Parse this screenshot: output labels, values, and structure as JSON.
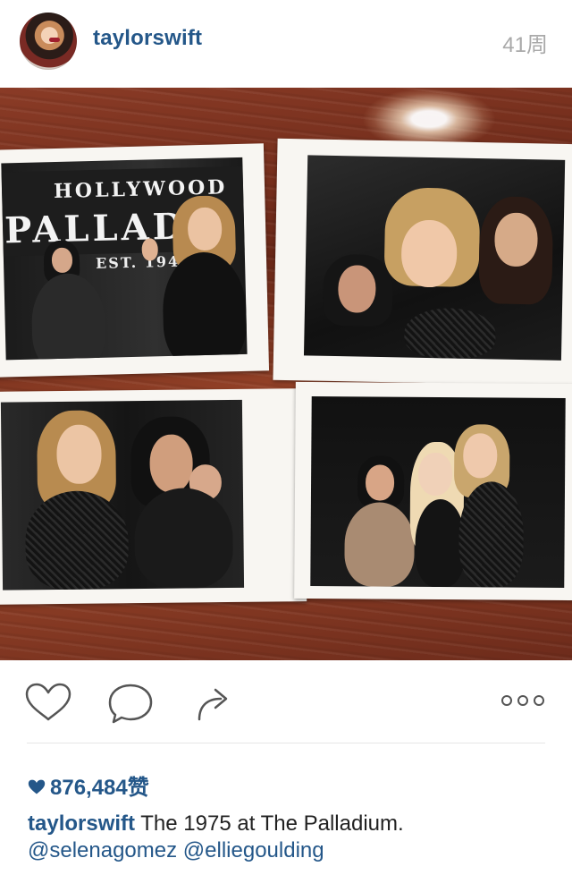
{
  "header": {
    "username": "taylorswift",
    "time_ago": "41周",
    "avatar_icon": "user-avatar"
  },
  "post": {
    "description": "",
    "photos": [
      {
        "sign_line1": "HOLLYWOOD",
        "sign_line2": "PALLAD",
        "sign_line3": "EST. 194"
      },
      {},
      {},
      {}
    ]
  },
  "actions": {
    "like_icon": "heart-outline-icon",
    "comment_icon": "comment-bubble-icon",
    "share_icon": "share-arrow-icon",
    "more_icon": "more-horizontal-icon"
  },
  "likes": {
    "icon": "heart-filled-icon",
    "count": "876,484",
    "suffix": "赞"
  },
  "caption": {
    "username": "taylorswift",
    "text": "The 1975 at The Palladium.",
    "mention_1": "@selenagomez",
    "mention_2": "@elliegoulding"
  },
  "colors": {
    "link": "#245789",
    "muted": "#a9a9a9",
    "icon": "#555555",
    "wood": "#7a301d"
  }
}
